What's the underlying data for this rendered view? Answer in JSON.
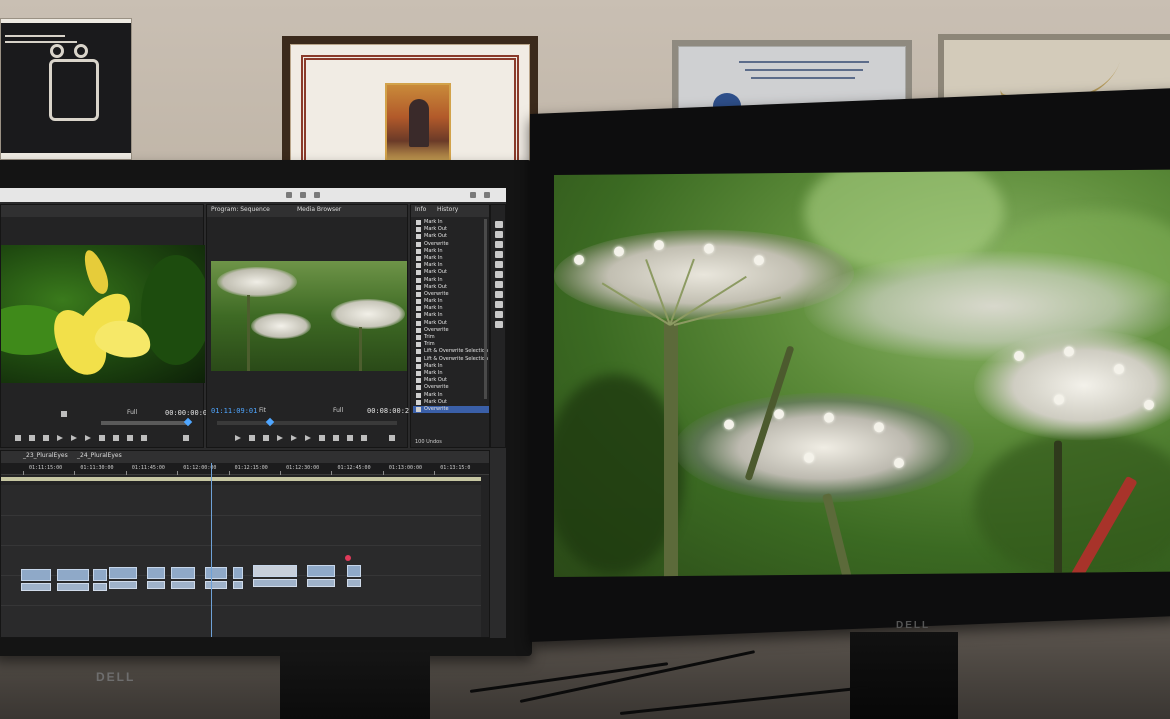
{
  "left_monitor": {
    "brand": "DELL",
    "program_panel": {
      "tabs": [
        "Program: Sequence",
        "Media Browser"
      ],
      "timecode": "01:11:09:01",
      "fit": "Fit",
      "zoom": "Full",
      "duration": "00:08:00:21"
    },
    "source_panel": {
      "zoom": "Full",
      "timecode": "00:00:00:07"
    },
    "history_panel": {
      "tabs": [
        "Info",
        "History"
      ],
      "items": [
        "Mark In",
        "Mark Out",
        "Mark Out",
        "Overwrite",
        "Mark In",
        "Mark In",
        "Mark In",
        "Mark Out",
        "Mark In",
        "Mark Out",
        "Overwrite",
        "Mark In",
        "Mark In",
        "Mark In",
        "Mark Out",
        "Overwrite",
        "Trim",
        "Trim",
        "Lift & Overwrite Selection",
        "Lift & Overwrite Selection",
        "Mark In",
        "Mark In",
        "Mark Out",
        "Overwrite",
        "Mark In",
        "Mark Out",
        "Overwrite"
      ],
      "selected_index": 26,
      "footer": "100 Undos"
    },
    "timeline": {
      "sequence_tabs": [
        "_23_PluralEyes",
        "_24_PluralEyes"
      ],
      "ruler_labels": [
        "01:11:15:00",
        "01:11:30:00",
        "01:11:45:00",
        "01:12:00:00",
        "01:12:15:00",
        "01:12:30:00",
        "01:12:45:00",
        "01:13:00:00",
        "01:13:15:0"
      ]
    }
  },
  "right_monitor": {
    "brand": "DELL"
  },
  "colors": {
    "timecode_blue": "#4fa6ff",
    "history_selected": "#3a5fa8",
    "clip_blue": "#8fa9c8"
  }
}
